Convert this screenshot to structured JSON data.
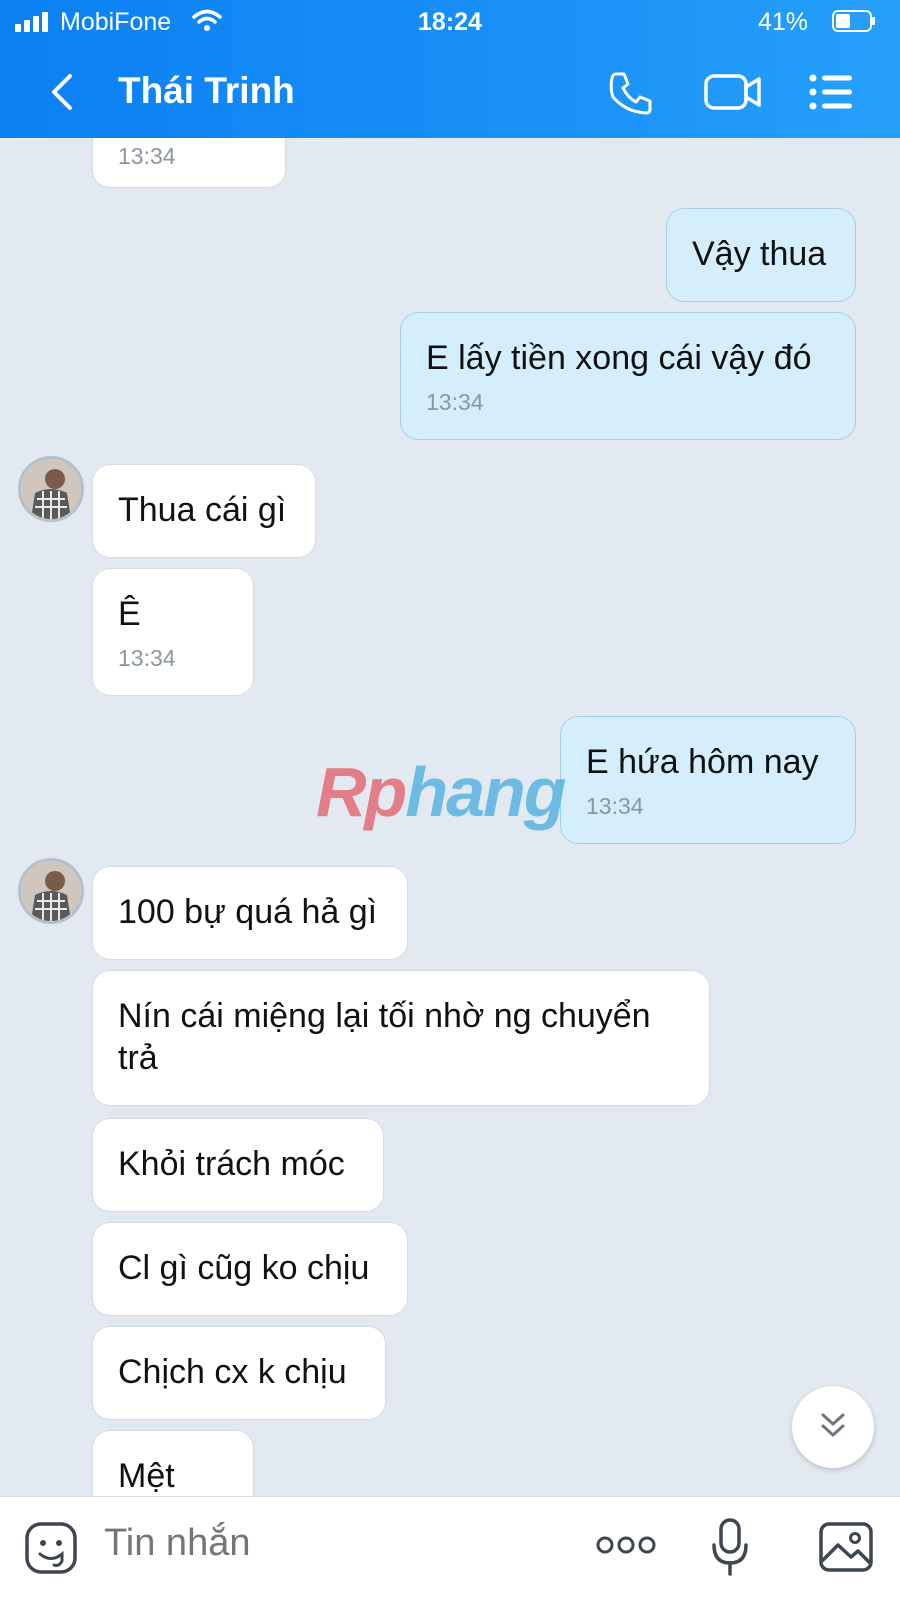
{
  "status_bar": {
    "carrier": "MobiFone",
    "time": "18:24",
    "battery_percent": "41%",
    "battery_level": 0.41,
    "icons": [
      "signal-icon",
      "wifi-icon",
      "battery-icon"
    ]
  },
  "header": {
    "title": "Thái Trinh",
    "icons": [
      "back-icon",
      "phone-icon",
      "video-call-icon",
      "menu-list-icon"
    ],
    "accent_color": "#0a80f3"
  },
  "messages": [
    {
      "side": "in",
      "text": "",
      "time": "13:34"
    },
    {
      "side": "out",
      "text": "Vậy thua",
      "time": ""
    },
    {
      "side": "out",
      "text": "E lấy tiền xong cái vậy đó",
      "time": "13:34"
    },
    {
      "side": "in",
      "text": "Thua cái gì",
      "time": ""
    },
    {
      "side": "in",
      "text": "Ê",
      "time": "13:34"
    },
    {
      "side": "out",
      "text": "E hứa hôm nay",
      "time": "13:34"
    },
    {
      "side": "in",
      "text": "100 bự quá hả gì",
      "time": ""
    },
    {
      "side": "in",
      "text": "Nín cái miệng lại tối nhờ ng chuyển trả",
      "time": ""
    },
    {
      "side": "in",
      "text": "Khỏi trách móc",
      "time": ""
    },
    {
      "side": "in",
      "text": "Cl gì cũg ko chịu",
      "time": ""
    },
    {
      "side": "in",
      "text": "Chịch cx k chịu",
      "time": ""
    },
    {
      "side": "in",
      "text": "Mệt",
      "time": ""
    }
  ],
  "watermark": {
    "part1": "Rp",
    "part2": "hang"
  },
  "composer": {
    "placeholder": "Tin nhắn",
    "icons": [
      "emoji-icon",
      "more-icon",
      "microphone-icon",
      "image-icon"
    ]
  },
  "colors": {
    "outgoing_bubble": "#d4eefc",
    "incoming_bubble": "#ffffff",
    "chat_background": "#e2e9f1"
  }
}
